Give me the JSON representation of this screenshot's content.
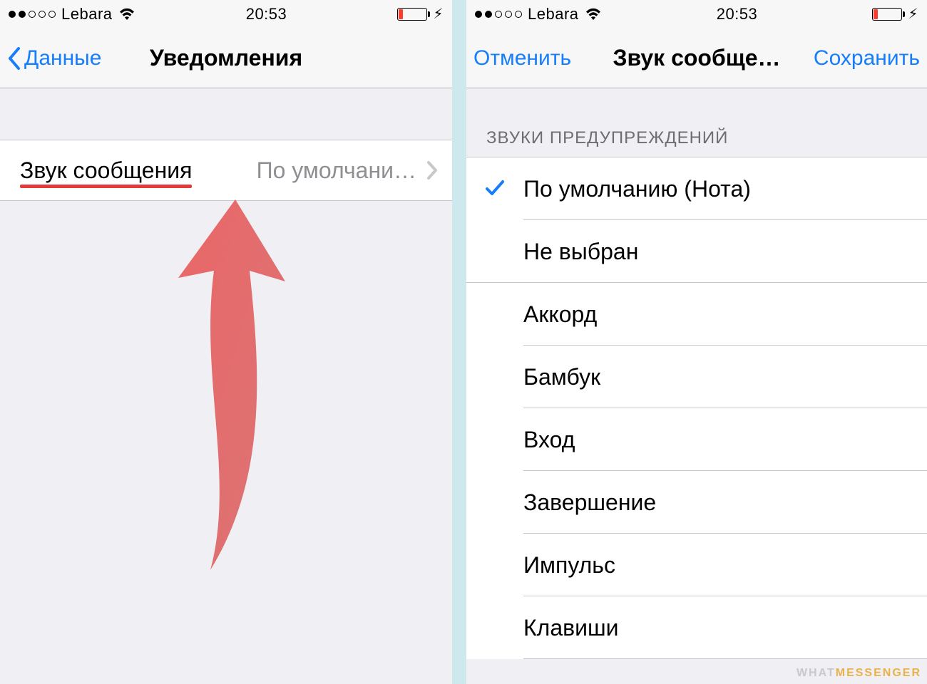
{
  "status_bar": {
    "carrier": "Lebara",
    "time": "20:53"
  },
  "left": {
    "nav": {
      "back_label": "Данные",
      "title": "Уведомления"
    },
    "row": {
      "label": "Звук сообщения",
      "value": "По умолчани…"
    }
  },
  "right": {
    "nav": {
      "cancel": "Отменить",
      "title": "Звук сообще…",
      "save": "Сохранить"
    },
    "section_header": "ЗВУКИ ПРЕДУПРЕЖДЕНИЙ",
    "sounds": [
      {
        "label": "По умолчанию (Нота)",
        "selected": true
      },
      {
        "label": "Не выбран",
        "selected": false
      },
      {
        "label": "Аккорд",
        "selected": false
      },
      {
        "label": "Бамбук",
        "selected": false
      },
      {
        "label": "Вход",
        "selected": false
      },
      {
        "label": "Завершение",
        "selected": false
      },
      {
        "label": "Импульс",
        "selected": false
      },
      {
        "label": "Клавиши",
        "selected": false
      }
    ]
  },
  "watermark": {
    "part1": "WHAT",
    "part2": "MESSENGER"
  }
}
